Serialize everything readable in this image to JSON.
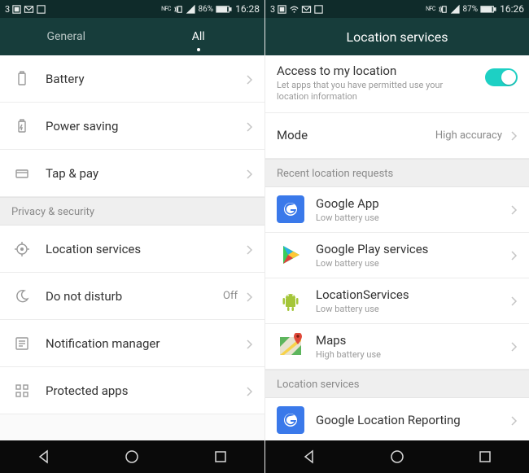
{
  "left": {
    "status": {
      "carrier": "3",
      "battery_pct": "86%",
      "time": "16:28"
    },
    "tabs": {
      "general": "General",
      "all": "All"
    },
    "rows": {
      "battery": "Battery",
      "power_saving": "Power saving",
      "tap_pay": "Tap & pay"
    },
    "section_privacy": "Privacy & security",
    "privacy_rows": {
      "location_services": "Location services",
      "do_not_disturb": {
        "label": "Do not disturb",
        "value": "Off"
      },
      "notification_manager": "Notification manager",
      "protected_apps": "Protected apps"
    }
  },
  "right": {
    "status": {
      "carrier": "3",
      "battery_pct": "87%",
      "time": "16:26"
    },
    "header_title": "Location services",
    "access": {
      "title": "Access to my location",
      "desc": "Let apps that you have permitted use your location information"
    },
    "mode": {
      "label": "Mode",
      "value": "High accuracy"
    },
    "section_recent": "Recent location requests",
    "apps": [
      {
        "name": "Google App",
        "sub": "Low battery use"
      },
      {
        "name": "Google Play services",
        "sub": "Low battery use"
      },
      {
        "name": "LocationServices",
        "sub": "Low battery use"
      },
      {
        "name": "Maps",
        "sub": "High battery use"
      }
    ],
    "section_loc": "Location services",
    "loc_rows": {
      "glr": "Google Location Reporting"
    }
  }
}
